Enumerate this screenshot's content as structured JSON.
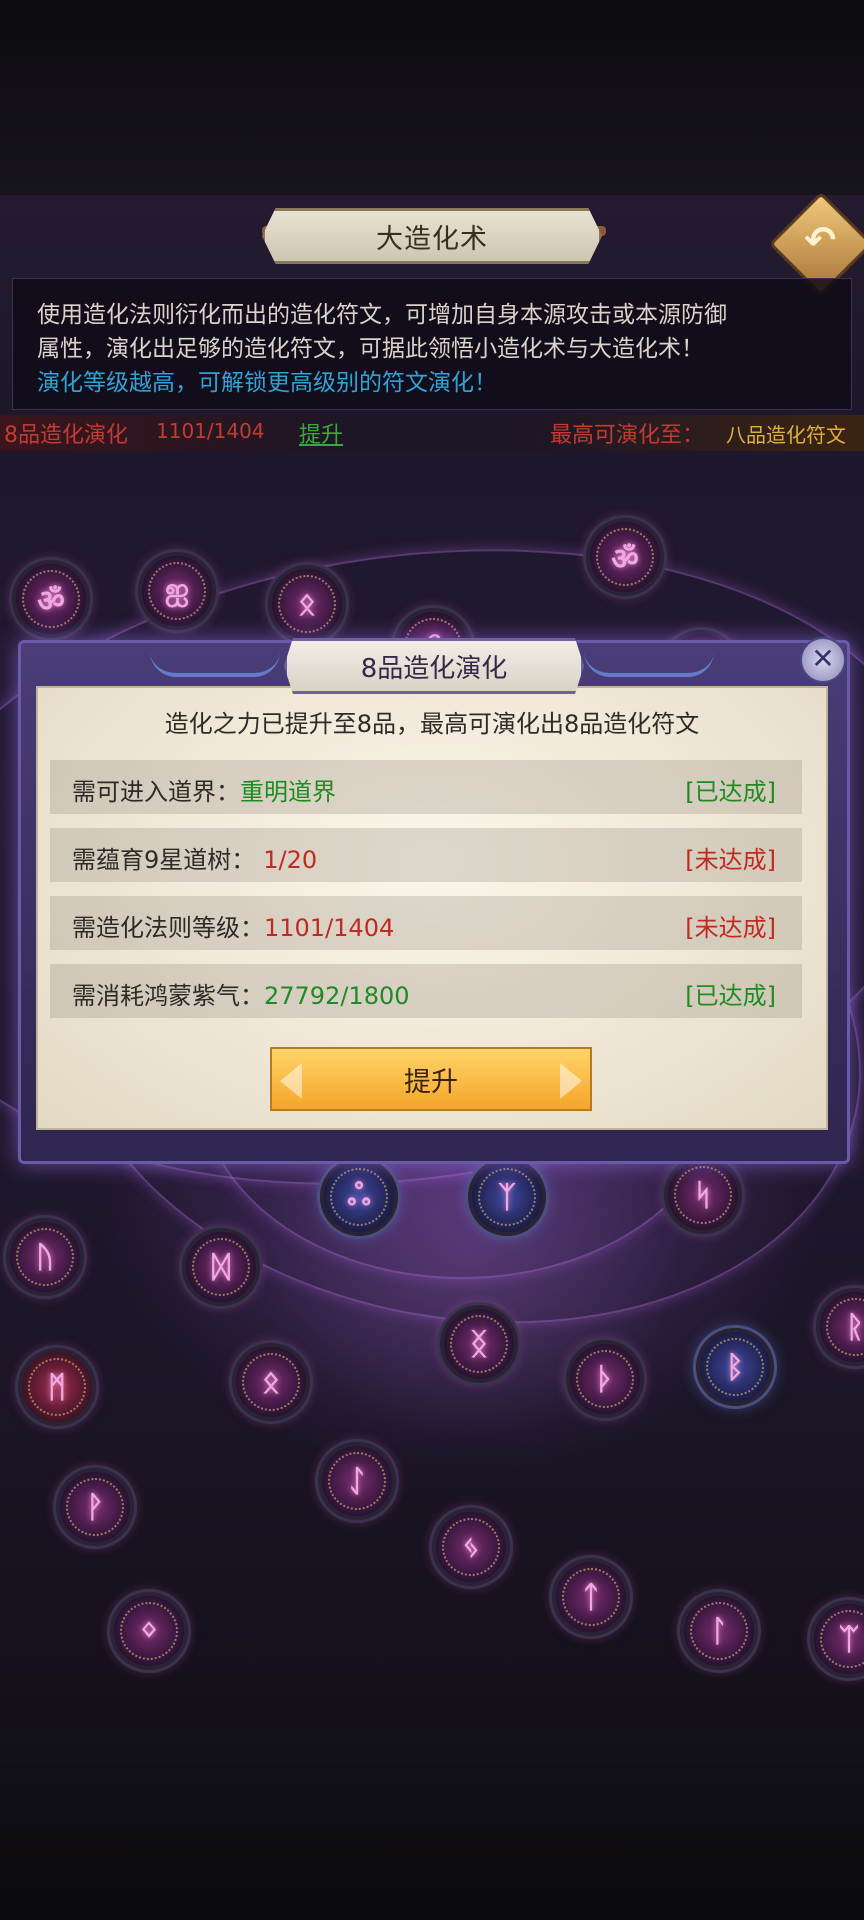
{
  "header": {
    "title": "大造化术",
    "description_line1": "使用造化法则衍化而出的造化符文，可增加自身本源攻击或本源防御",
    "description_line2": "属性，演化出足够的造化符文，可据此领悟小造化术与大造化术！",
    "description_highlight": "演化等级越高，可解锁更高级别的符文演化！"
  },
  "status": {
    "level_label": "8品造化演化",
    "progress": "1101/1404",
    "upgrade_link": "提升",
    "max_label": "最高可演化至：",
    "max_rank": "八品造化符文"
  },
  "modal": {
    "title": "8品造化演化",
    "subtitle": "造化之力已提升至8品，最高可演化出8品造化符文",
    "requirements": [
      {
        "label": "需可进入道界：",
        "value": "重明道界",
        "status": "[已达成]",
        "met": true
      },
      {
        "label": "需蕴育9星道树：",
        "value": "1/20",
        "status": "[未达成]",
        "met": false
      },
      {
        "label": "需造化法则等级：",
        "value": "1101/1404",
        "status": "[未达成]",
        "met": false
      },
      {
        "label": "需消耗鸿蒙紫气：",
        "value": "27792/1800",
        "status": "[已达成]",
        "met": true
      }
    ],
    "button_label": "提升",
    "close_glyph": "✕"
  },
  "board": {
    "glyphs": [
      "ॐ",
      "ஐ",
      "ᛟ",
      "ॐ",
      "ℰ",
      "ᚠ",
      "ஃ",
      "ᛉ",
      "ᛋ",
      "ᚢ",
      "ᛞ",
      "ᚱ",
      "ᛝ",
      "ᚦ",
      "ᛒ",
      "ᛗ",
      "ᛟ",
      "ᚹ",
      "ᛇ",
      "ᛃ",
      "ᛏ",
      "ᛚ",
      "ᛜ",
      "ᛠ"
    ]
  },
  "colors": {
    "met": "#1f8b22",
    "unmet": "#c02a20",
    "highlight": "#2fa3d6",
    "accent_button": "#f5a52a"
  }
}
